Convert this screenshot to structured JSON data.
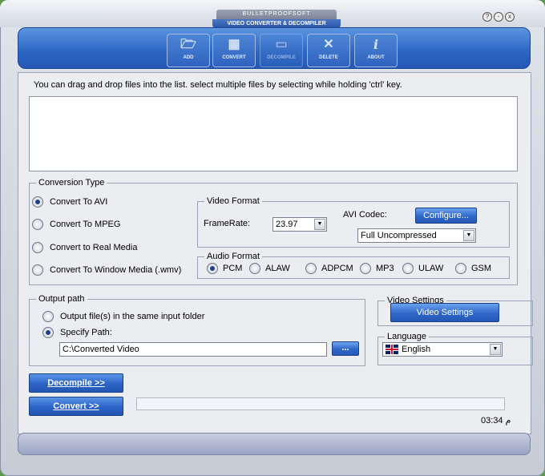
{
  "window": {
    "brand": "BULLETPROOFSOFT",
    "title": "VIDEO CONVERTER & DECOMPILER",
    "controls": [
      "?",
      "-",
      "x"
    ]
  },
  "toolbar": {
    "buttons": [
      {
        "label": "ADD",
        "icon": "folder-open-icon",
        "glyph": "🗁"
      },
      {
        "label": "CONVERT",
        "icon": "grid-icon",
        "glyph": "▦"
      },
      {
        "label": "DECOMPILE",
        "icon": "film-icon",
        "glyph": "▭"
      },
      {
        "label": "DELETE",
        "icon": "delete-x-icon",
        "glyph": "✕"
      },
      {
        "label": "ABOUT",
        "icon": "info-icon",
        "glyph": "i"
      }
    ]
  },
  "hint": "You can drag and drop files into the list. select multiple files by selecting while holding 'ctrl' key.",
  "conversion_type": {
    "legend": "Conversion Type",
    "options": [
      {
        "label": "Convert To AVI",
        "selected": true
      },
      {
        "label": "Convert To MPEG",
        "selected": false
      },
      {
        "label": "Convert to Real Media",
        "selected": false
      },
      {
        "label": "Convert To Window Media (.wmv)",
        "selected": false
      }
    ]
  },
  "video_format": {
    "legend": "Video Format",
    "framerate_label": "FrameRate:",
    "framerate_value": "23.97",
    "codec_label": "AVI Codec:",
    "configure_label": "Configure...",
    "codec_value": "Full Uncompressed"
  },
  "audio_format": {
    "legend": "Audio Format",
    "options": [
      {
        "label": "PCM",
        "selected": true
      },
      {
        "label": "ALAW",
        "selected": false
      },
      {
        "label": "ADPCM",
        "selected": false
      },
      {
        "label": "MP3",
        "selected": false
      },
      {
        "label": "ULAW",
        "selected": false
      },
      {
        "label": "GSM",
        "selected": false
      }
    ]
  },
  "output_path": {
    "legend": "Output path",
    "same_folder_label": "Output file(s) in the same input folder",
    "same_folder_selected": false,
    "specify_label": "Specify Path:",
    "specify_selected": true,
    "path_value": "C:\\Converted Video",
    "browse_label": "..."
  },
  "video_settings": {
    "legend": "Video Settings",
    "button_label": "Video Settings"
  },
  "language": {
    "legend": "Language",
    "value": "English",
    "flag_icon": "uk-flag-icon"
  },
  "actions": {
    "decompile_label": "Decompile >>",
    "convert_label": "Convert >>"
  },
  "status": {
    "time": "03:34 م"
  }
}
